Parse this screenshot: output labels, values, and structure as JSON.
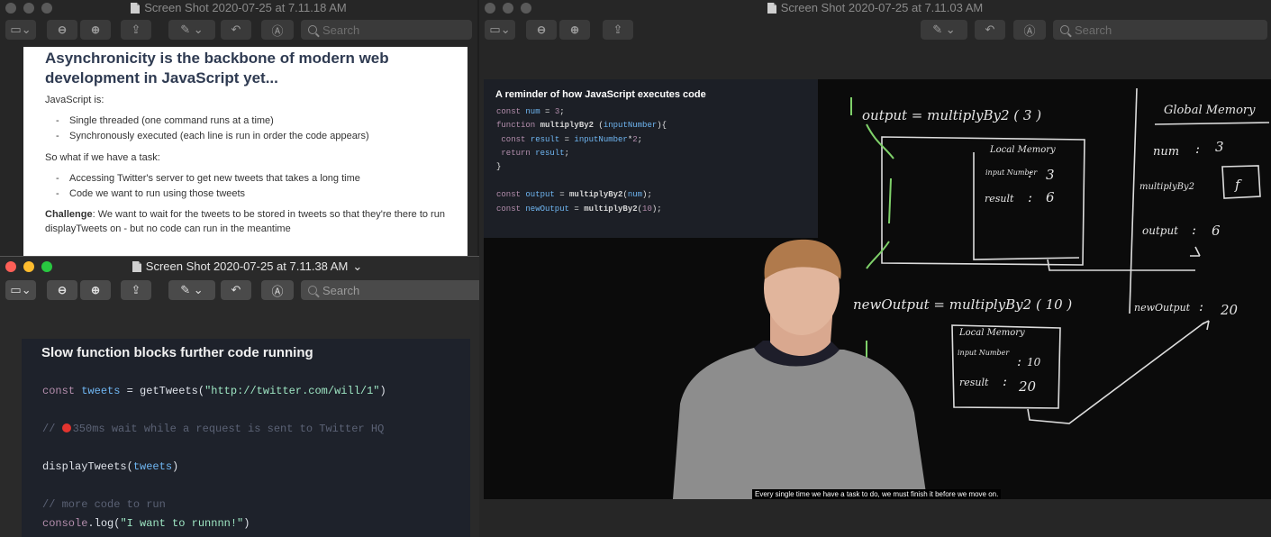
{
  "windows": {
    "left_back": {
      "title": "Screen Shot 2020-07-25 at 7.11.18 AM",
      "search_placeholder": "Search",
      "slide": {
        "heading": "Asynchronicity is the backbone of modern web development in JavaScript yet...",
        "js_is": "JavaScript is:",
        "points1": [
          "Single threaded (one command runs at a time)",
          "Synchronously executed (each line is run in order the code appears)"
        ],
        "sowhat": "So what if we have a task:",
        "points2": [
          "Accessing Twitter's server to get new tweets that takes a long time",
          "Code we want to run using those tweets"
        ],
        "challenge_label": "Challenge",
        "challenge_text": ": We want to wait for the tweets to be stored in tweets so that they're there to run displayTweets on - but no code can run in the meantime"
      }
    },
    "left_front": {
      "title": "Screen Shot 2020-07-25 at 7.11.38 AM",
      "title_chevron": "⌄",
      "search_placeholder": "Search",
      "slide": {
        "heading": "Slow function blocks further code running",
        "line1": {
          "kw": "const",
          "var": "tweets",
          "op": " = getTweets(",
          "str": "\"http://twitter.com/will/1\"",
          "end": ")"
        },
        "line2": {
          "pre": "// ",
          "text": "350ms wait while a request is sent to Twitter HQ"
        },
        "line3": {
          "fn": "displayTweets(",
          "var": "tweets",
          "end": ")"
        },
        "line4": "// more code to run",
        "line5": {
          "kw": "console",
          "mid": ".log(",
          "str": "\"I want to runnnn!\"",
          "end": ")"
        }
      }
    },
    "right": {
      "title": "Screen Shot 2020-07-25 at 7.11.03 AM",
      "search_placeholder": "Search",
      "code": {
        "heading": "A reminder of how JavaScript executes code",
        "lines": [
          "const num = 3;",
          "function multiplyBy2 (inputNumber){",
          " const result = inputNumber*2;",
          " return result;",
          "}",
          "",
          "const output = multiplyBy2(num);",
          "const newOutput = multiplyBy2(10);"
        ]
      },
      "board": {
        "output_eq": "output  =  multiplyBy2 ( 3 )",
        "local_memory": "Local Memory",
        "input_number": "input Number",
        "colon": ":",
        "val3": "3",
        "result": "result",
        "val6": "6",
        "global_memory": "Global Memory",
        "num": "num",
        "multiply": "multiplyBy2",
        "f": "f",
        "output": "output",
        "newoutput_eq": "newOutput  =  multiplyBy2 ( 10 )",
        "val10": "10",
        "val20": "20",
        "newoutput": "newOutput"
      },
      "caption": "Every single time we have a task to do, we must finish it before we move on."
    }
  },
  "colors": {
    "window_bg": "#262626",
    "slide_bg": "#ffffff",
    "code_bg": "#1e222b",
    "keyword": "#b48ead",
    "variable": "#6fb6f2",
    "string": "#9ee6c3"
  }
}
